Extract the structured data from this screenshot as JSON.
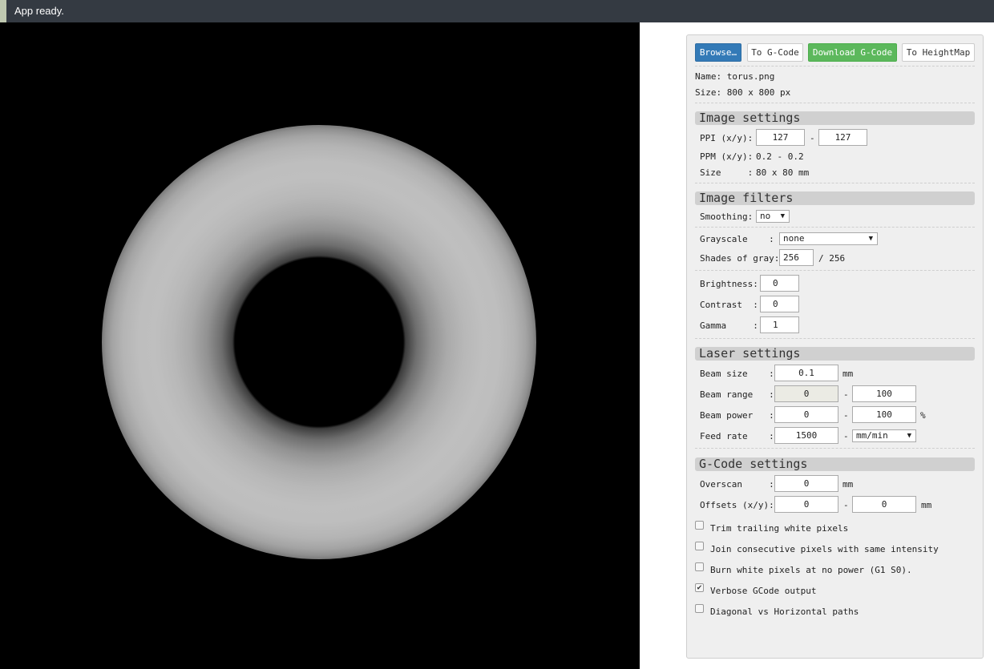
{
  "status": {
    "text": "App ready."
  },
  "toolbar": {
    "browse": "Browse…",
    "to_gcode": "To G-Code",
    "download_gcode": "Download G-Code",
    "to_heightmap": "To HeightMap"
  },
  "file": {
    "name": "Name: torus.png",
    "size": "Size: 800 x 800 px"
  },
  "image_settings": {
    "title": "Image settings",
    "ppi_label": "PPI (x/y):",
    "ppi_x": "127",
    "ppi_y": "127",
    "dash": "-",
    "ppm_label": "PPM (x/y):",
    "ppm_value": "0.2 - 0.2",
    "size_label": "Size     :",
    "size_value": "80 x 80 mm"
  },
  "image_filters": {
    "title": "Image filters",
    "smoothing_label": "Smoothing:",
    "smoothing_value": "no",
    "grayscale_label": "Grayscale    :",
    "grayscale_value": "none",
    "shades_label": "Shades of gray:",
    "shades_value": "256",
    "shades_max": "/ 256",
    "brightness_label": "Brightness:",
    "brightness_value": "0",
    "contrast_label": "Contrast  :",
    "contrast_value": "0",
    "gamma_label": "Gamma     :",
    "gamma_value": "1"
  },
  "laser_settings": {
    "title": "Laser settings",
    "beam_size_label": "Beam size    :",
    "beam_size_value": "0.1",
    "beam_size_unit": "mm",
    "beam_range_label": "Beam range   :",
    "beam_range_min": "0",
    "beam_range_max": "100",
    "beam_power_label": "Beam power   :",
    "beam_power_min": "0",
    "beam_power_max": "100",
    "beam_power_unit": "%",
    "feed_rate_label": "Feed rate    :",
    "feed_rate_value": "1500",
    "feed_rate_unit": "mm/min",
    "dash": "-"
  },
  "gcode_settings": {
    "title": "G-Code settings",
    "overscan_label": "Overscan     :",
    "overscan_value": "0",
    "overscan_unit": "mm",
    "offsets_label": "Offsets (x/y):",
    "offset_x": "0",
    "offset_y": "0",
    "offsets_unit": "mm",
    "dash": "-",
    "options": [
      {
        "label": "Trim trailing white pixels",
        "checked": false
      },
      {
        "label": "Join consecutive pixels with same intensity",
        "checked": false
      },
      {
        "label": "Burn white pixels at no power (G1 S0).",
        "checked": false
      },
      {
        "label": "Verbose GCode output",
        "checked": true
      },
      {
        "label": "Diagonal vs Horizontal paths",
        "checked": false
      }
    ],
    "check_mark": "✔"
  },
  "colors": {
    "status_bar": "#343a42",
    "primary_button": "#337ab7",
    "success_button": "#5cb85c",
    "panel_bg": "#efefef",
    "section_header": "#d0d0d0"
  },
  "icons": {
    "dropdown": "▼"
  }
}
